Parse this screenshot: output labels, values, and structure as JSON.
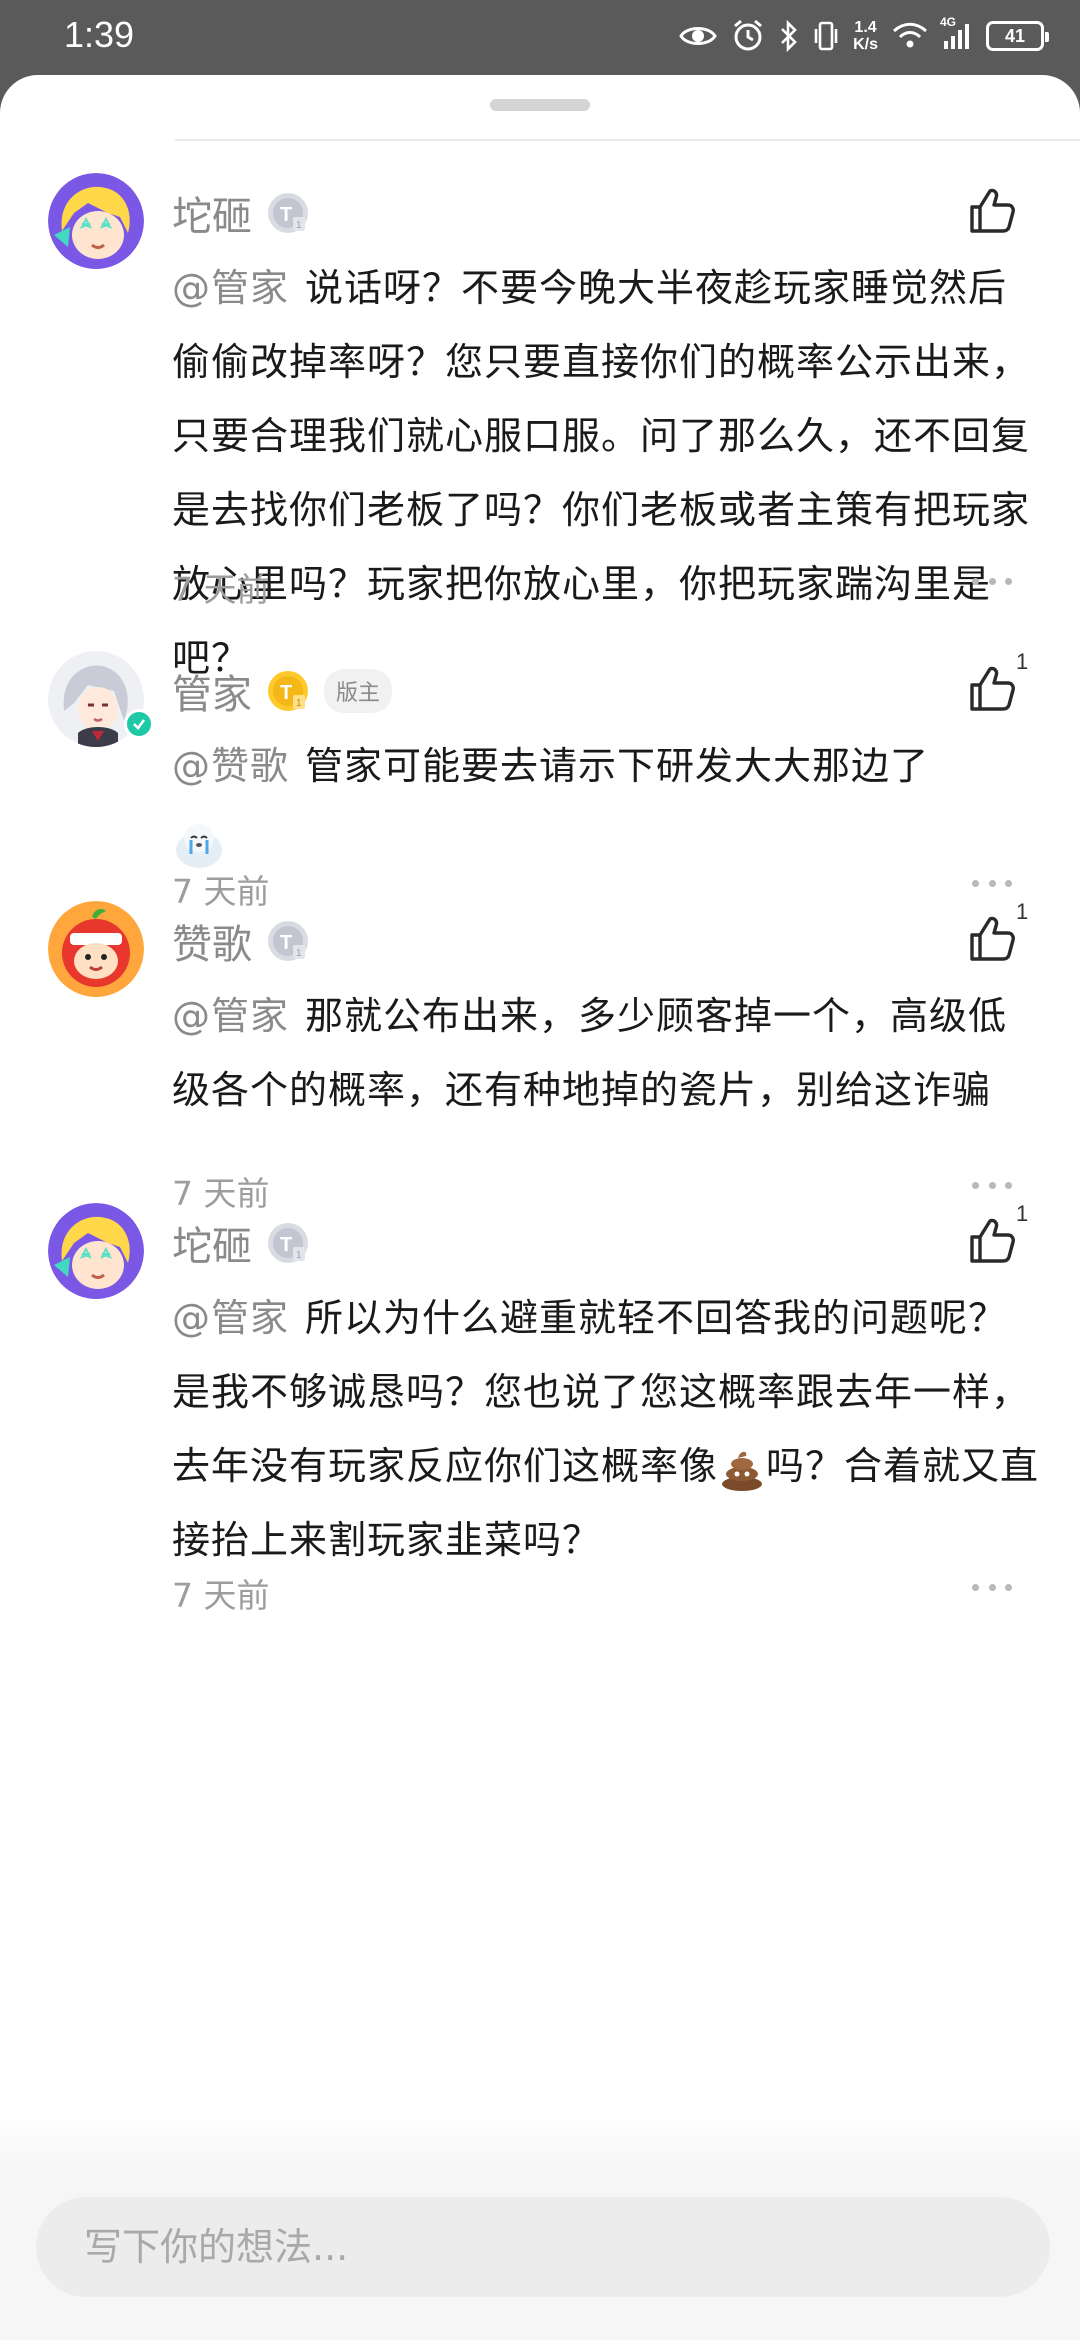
{
  "status_bar": {
    "time": "1:39",
    "net_speed_value": "1.4",
    "net_speed_unit": "K/s",
    "network_type": "4G",
    "battery": "41",
    "icons": [
      "eye-icon",
      "alarm-icon",
      "bluetooth-icon",
      "vibrate-icon",
      "wifi-icon",
      "signal-icon",
      "battery-icon"
    ]
  },
  "comments": [
    {
      "username": "坨砸",
      "level": "T1",
      "likes": "",
      "mention": "@管家",
      "text": "说话呀？不要今晚大半夜趁玩家睡觉然后偷偷改掉率呀？您只要直接你们的概率公示出来，只要合理我们就心服口服。问了那么久，还不回复是去找你们老板了吗？你们老板或者主策有把玩家放心里吗？玩家把你放心里，你把玩家踹沟里是吧？",
      "time": "7 天前"
    },
    {
      "username": "管家",
      "level": "T1",
      "role_badge": "版主",
      "likes": "1",
      "mention": "@赞歌",
      "text": "管家可能要去请示下研发大大那边了",
      "time": "7 天前"
    },
    {
      "username": "赞歌",
      "level": "T1",
      "likes": "1",
      "mention": "@管家",
      "text": "那就公布出来，多少顾客掉一个，高级低级各个的概率，还有种地掉的瓷片，别给这诈骗",
      "time": "7 天前"
    },
    {
      "username": "坨砸",
      "level": "T1",
      "likes": "1",
      "mention": "@管家",
      "text_before_emoji": "所以为什么避重就轻不回答我的问题呢？是我不够诚恳吗？您也说了您这概率跟去年一样，去年没有玩家反应你们这概率像",
      "text_after_emoji": "吗？合着就又直接抬上来割玩家韭菜吗？",
      "time": "7 天前"
    }
  ],
  "input": {
    "placeholder": "写下你的想法..."
  },
  "colors": {
    "status_bar_bg": "#5a5a5a",
    "username": "#8a8a8a",
    "verified": "#1ec9a5",
    "gold_badge": "#f5b617"
  }
}
